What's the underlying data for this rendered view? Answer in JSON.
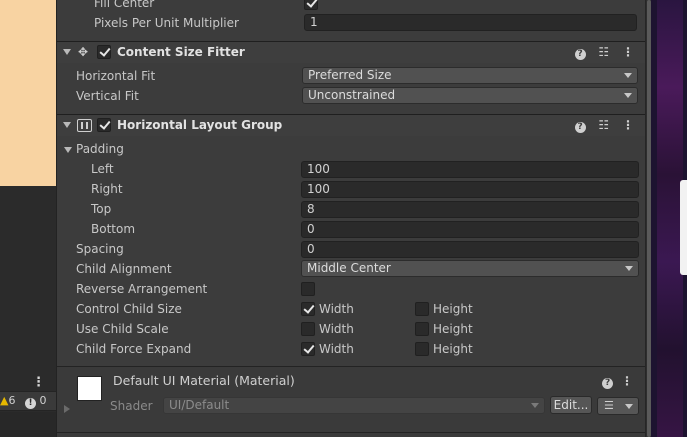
{
  "scene": {
    "warning_count": "6",
    "error_count": "0"
  },
  "image": {
    "fill_center_label": "Fill Center",
    "fill_center_checked": true,
    "ppu_label": "Pixels Per Unit Multiplier",
    "ppu_value": "1"
  },
  "content_size_fitter": {
    "title": "Content Size Fitter",
    "enabled": true,
    "horizontal_fit_label": "Horizontal Fit",
    "horizontal_fit_value": "Preferred Size",
    "vertical_fit_label": "Vertical Fit",
    "vertical_fit_value": "Unconstrained"
  },
  "horizontal_layout_group": {
    "title": "Horizontal Layout Group",
    "enabled": true,
    "padding_label": "Padding",
    "left_label": "Left",
    "left_value": "100",
    "right_label": "Right",
    "right_value": "100",
    "top_label": "Top",
    "top_value": "8",
    "bottom_label": "Bottom",
    "bottom_value": "0",
    "spacing_label": "Spacing",
    "spacing_value": "0",
    "child_alignment_label": "Child Alignment",
    "child_alignment_value": "Middle Center",
    "reverse_label": "Reverse Arrangement",
    "reverse_checked": false,
    "control_size_label": "Control Child Size",
    "use_scale_label": "Use Child Scale",
    "force_expand_label": "Child Force Expand",
    "width_label": "Width",
    "height_label": "Height",
    "control_size_width": true,
    "control_size_height": false,
    "use_scale_width": false,
    "use_scale_height": false,
    "force_expand_width": true,
    "force_expand_height": false
  },
  "material": {
    "title": "Default UI Material (Material)",
    "shader_label": "Shader",
    "shader_value": "UI/Default",
    "edit_label": "Edit..."
  },
  "icons": {
    "help": "help-icon",
    "presets": "presets-icon",
    "menu": "kebab-menu-icon",
    "component_fitter": "content-size-fitter-icon",
    "component_layout": "horizontal-layout-icon"
  },
  "colors": {
    "panel_bg": "#3c3c3c",
    "field_bg": "#2a2a2a",
    "dropdown_bg": "#515151",
    "scene_peach": "#f8d3a2",
    "warning_yellow": "#e6b800"
  }
}
